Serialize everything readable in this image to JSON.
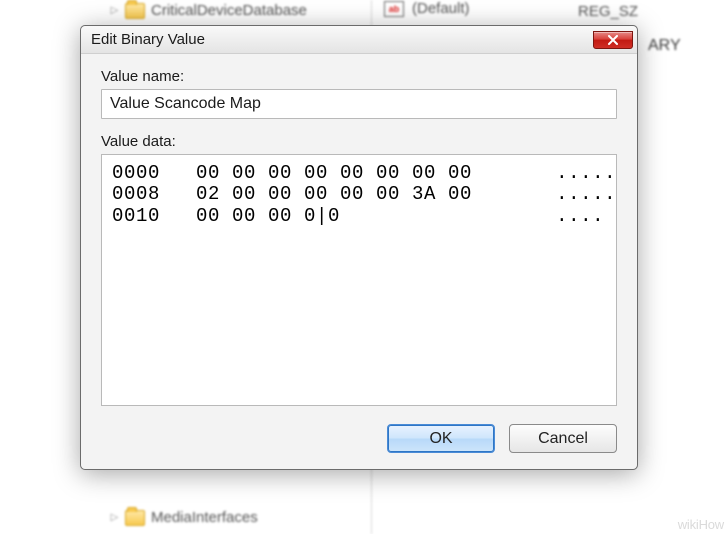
{
  "background": {
    "tree_top_item": "CriticalDeviceDatabase",
    "tree_bottom_item": "MediaInterfaces",
    "value_name": "(Default)",
    "value_type_left": "REG_SZ",
    "value_type_right": "ARY"
  },
  "dialog": {
    "title": "Edit Binary Value",
    "labels": {
      "value_name": "Value name:",
      "value_data": "Value data:"
    },
    "value_name_input": "Value Scancode Map",
    "hex_rows": [
      {
        "offset": "0000",
        "bytes": "00 00 00 00 00 00 00 00",
        "ascii": "........"
      },
      {
        "offset": "0008",
        "bytes": "02 00 00 00 00 00 3A 00",
        "ascii": "......:."
      },
      {
        "offset": "0010",
        "bytes": "00 00 00 0|0",
        "ascii": "...."
      }
    ],
    "buttons": {
      "ok": "OK",
      "cancel": "Cancel"
    }
  },
  "watermark": "wikiHow"
}
